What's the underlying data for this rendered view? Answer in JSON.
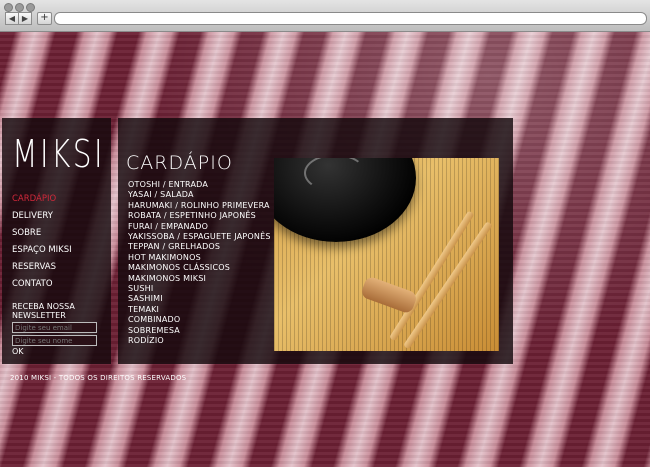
{
  "site": {
    "logo_text": "MIKSI",
    "footer": "2010 MIKSI - TODOS OS DIREITOS RESERVADOS"
  },
  "nav": {
    "items": [
      {
        "label": "CARDÁPIO",
        "active": true
      },
      {
        "label": "DELIVERY",
        "active": false
      },
      {
        "label": "SOBRE",
        "active": false
      },
      {
        "label": "ESPAÇO MIKSI",
        "active": false
      },
      {
        "label": "RESERVAS",
        "active": false
      },
      {
        "label": "CONTATO",
        "active": false
      }
    ]
  },
  "newsletter": {
    "title": "RECEBA NOSSA NEWSLETTER",
    "email_placeholder": "Digite seu email",
    "name_placeholder": "Digite seu nome",
    "submit_label": "OK"
  },
  "menu": {
    "heading": "CARDÁPIO",
    "items": [
      "OTOSHI / ENTRADA",
      "YASAI / SALADA",
      "HARUMAKI / ROLINHO PRIMEVERA",
      "ROBATA / ESPETINHO JAPONÊS",
      "FURAI / EMPANADO",
      "YAKISSOBA / ESPAGUETE JAPONÊS",
      "TEPPAN / GRELHADOS",
      "HOT MAKIMONOS",
      "MAKIMONOS CLÁSSICOS",
      "MAKIMONOS MIKSI",
      "SUSHI",
      "SASHIMI",
      "TEMAKI",
      "COMBINADO",
      "SOBREMESA",
      "RODÍZIO"
    ]
  },
  "colors": {
    "active_link": "#d0283a",
    "panel_bg": "#14080c",
    "text": "#ffffff"
  },
  "icons": {
    "back": "back-arrow-icon",
    "forward": "forward-arrow-icon",
    "add_tab": "plus-icon"
  }
}
